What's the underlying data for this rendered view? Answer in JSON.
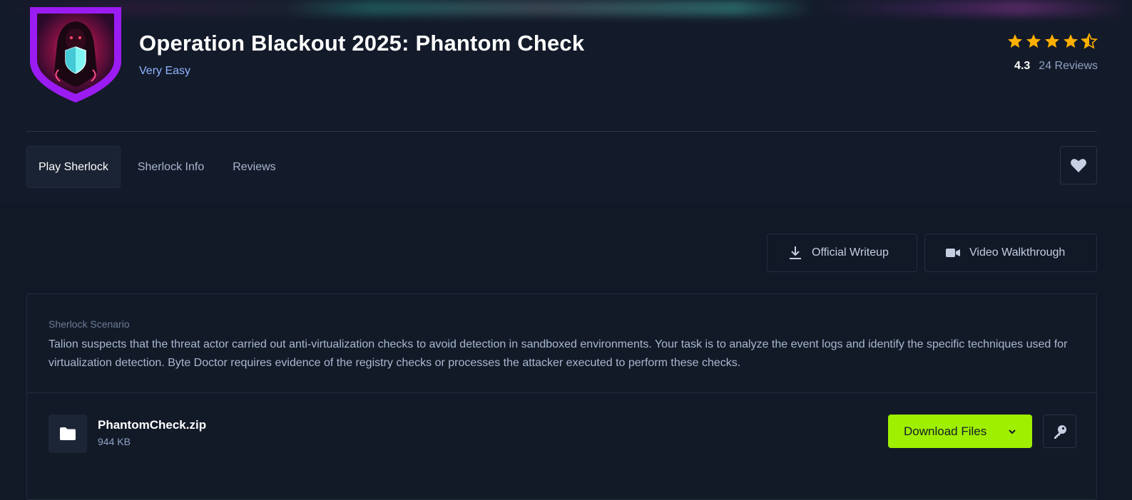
{
  "challenge": {
    "title": "Operation Blackout 2025: Phantom Check",
    "difficulty": "Very Easy",
    "rating": "4.3",
    "rating_stars": 4.5,
    "reviews": "24 Reviews"
  },
  "tabs": [
    {
      "label": "Play Sherlock",
      "active": true
    },
    {
      "label": "Sherlock Info",
      "active": false
    },
    {
      "label": "Reviews",
      "active": false
    }
  ],
  "actions": {
    "writeup": "Official Writeup",
    "video": "Video Walkthrough"
  },
  "scenario": {
    "label": "Sherlock Scenario",
    "text": "Talion suspects that the threat actor carried out anti-virtualization checks to avoid detection in sandboxed environments. Your task is to analyze the event logs and identify the specific techniques used for virtualization detection. Byte Doctor requires evidence of the registry checks or processes the attacker executed to perform these checks."
  },
  "file": {
    "name": "PhantomCheck.zip",
    "size": "944 KB",
    "download_label": "Download Files"
  },
  "icons": {
    "badge": "hooded-hacker-shield-badge",
    "favorite": "heart-icon",
    "writeup": "download-icon",
    "video": "video-camera-icon",
    "file": "folder-icon",
    "dropdown": "chevron-down-icon",
    "key": "key-icon"
  },
  "colors": {
    "accent": "#9fef00",
    "star": "#ffaf00",
    "difficulty": "#8fb4ff",
    "badge_purple": "#9b1cf2"
  }
}
